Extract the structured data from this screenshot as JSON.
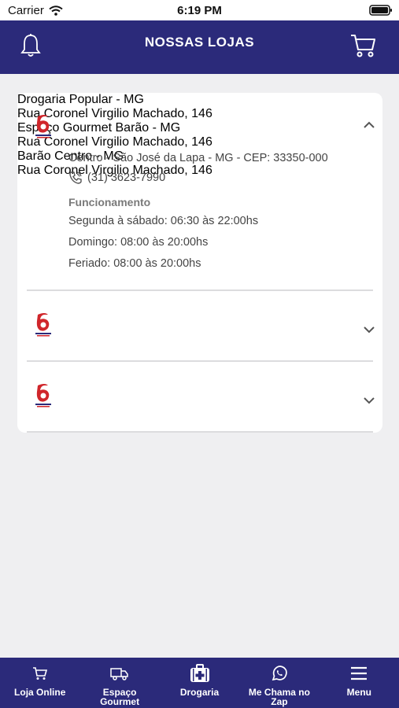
{
  "status_bar": {
    "carrier": "Carrier",
    "time": "6:19 PM"
  },
  "header": {
    "title": "NOSSAS LOJAS"
  },
  "stores": [
    {
      "name": "Drogaria Popular - MG",
      "address": "Rua Coronel Virgilio Machado, 146",
      "district": "Centro - São José da Lapa - MG - CEP: 33350-000",
      "phone": "(31) 3623-7990",
      "hours_title": "Funcionamento",
      "hours": [
        "Segunda à sábado: 06:30 às 22:00hs",
        "Domingo: 08:00 às 20:00hs",
        "Feriado: 08:00 às 20:00hs"
      ],
      "expanded": true
    },
    {
      "name": "Espaço Gourmet Barão - MG",
      "address": "Rua Coronel Virgilio Machado, 146",
      "expanded": false
    },
    {
      "name": "Barão Centro - MG",
      "address": "Rua Coronel Virgilio Machado, 146",
      "expanded": false
    }
  ],
  "tabbar": {
    "items": [
      {
        "label": "Loja Online",
        "icon": "cart-icon"
      },
      {
        "label": "Espaço Gourmet",
        "icon": "truck-icon"
      },
      {
        "label": "Drogaria",
        "icon": "medkit-icon"
      },
      {
        "label": "Me Chama no Zap",
        "icon": "whatsapp-icon"
      },
      {
        "label": "Menu",
        "icon": "menu-icon"
      }
    ]
  },
  "colors": {
    "brand": "#2b2a7a",
    "logo_red": "#d0262b",
    "background": "#efeff1"
  }
}
